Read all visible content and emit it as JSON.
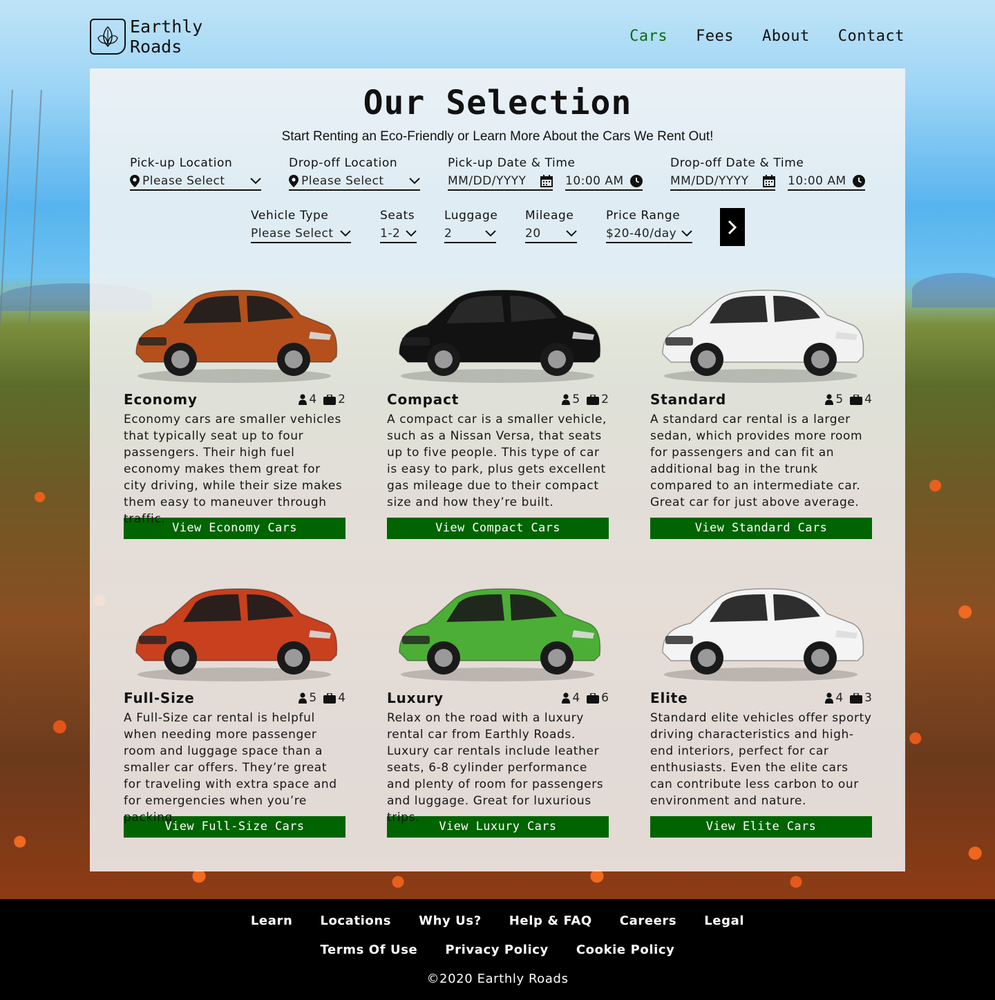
{
  "brand": {
    "line1": "Earthly",
    "line2": "Roads"
  },
  "nav": {
    "cars": "Cars",
    "fees": "Fees",
    "about": "About",
    "contact": "Contact"
  },
  "colors": {
    "accent": "#0b6b12",
    "button": "#006400",
    "footer": "#000000"
  },
  "main": {
    "title": "Our Selection",
    "subtitle": "Start Renting an Eco-Friendly or Learn More About the Cars We Rent Out!"
  },
  "form": {
    "pickup_location": {
      "label": "Pick-up Location",
      "value": "Please Select"
    },
    "dropoff_location": {
      "label": "Drop-off Location",
      "value": "Please Select"
    },
    "pickup_datetime": {
      "label": "Pick-up Date & Time",
      "date": "MM/DD/YYYY",
      "time": "10:00 AM"
    },
    "dropoff_datetime": {
      "label": "Drop-off Date & Time",
      "date": "MM/DD/YYYY",
      "time": "10:00 AM"
    },
    "vehicle_type": {
      "label": "Vehicle Type",
      "value": "Please Select"
    },
    "seats": {
      "label": "Seats",
      "value": "1-2"
    },
    "luggage": {
      "label": "Luggage",
      "value": "2"
    },
    "mileage": {
      "label": "Mileage",
      "value": "20"
    },
    "price_range": {
      "label": "Price Range",
      "value": "$20-40/day"
    }
  },
  "cards": [
    {
      "title": "Economy",
      "seats": "4",
      "bags": "2",
      "color": "#b5501c",
      "desc": "Economy cars are smaller vehicles that typically seat up to four passengers. Their high fuel economy makes them great for city driving, while their size makes them easy to maneuver through traffic.",
      "button": "View Economy Cars"
    },
    {
      "title": "Compact",
      "seats": "5",
      "bags": "2",
      "color": "#121212",
      "desc": "A compact car is a smaller vehicle, such as a Nissan Versa, that seats up to five people. This type of car is easy to park, plus gets excellent gas mileage due to their compact size and how they’re built.",
      "button": "View Compact Cars"
    },
    {
      "title": "Standard",
      "seats": "5",
      "bags": "4",
      "color": "#f2f2f2",
      "desc": "A standard car rental is a larger sedan, which provides more room for passengers and can fit an additional bag in the trunk compared to an intermediate car. Great car for just above average.",
      "button": "View Standard Cars"
    },
    {
      "title": "Full-Size",
      "seats": "5",
      "bags": "4",
      "color": "#c8401e",
      "desc": "A Full-Size car rental is helpful when needing more passenger room and luggage space than a smaller car offers. They’re great for traveling with extra space and for emergencies when you’re packing.",
      "button": "View Full-Size Cars"
    },
    {
      "title": "Luxury",
      "seats": "4",
      "bags": "6",
      "color": "#4cae36",
      "desc": "Relax on the road with a luxury rental car from Earthly Roads. Luxury car rentals include leather seats, 6-8 cylinder performance and plenty of room for passengers and luggage. Great for luxurious trips.",
      "button": "View Luxury Cars"
    },
    {
      "title": "Elite",
      "seats": "4",
      "bags": "3",
      "color": "#f4f4f4",
      "desc": "Standard elite vehicles offer sporty driving characteristics and high-end interiors, perfect for car enthusiasts. Even the elite cars can contribute less carbon to our environment and nature.",
      "button": "View Elite Cars"
    }
  ],
  "footer": {
    "links1": [
      "Learn",
      "Locations",
      "Why Us?",
      "Help & FAQ",
      "Careers",
      "Legal"
    ],
    "links2": [
      "Terms Of Use",
      "Privacy Policy",
      "Cookie Policy"
    ],
    "copyright": "©2020 Earthly Roads"
  }
}
